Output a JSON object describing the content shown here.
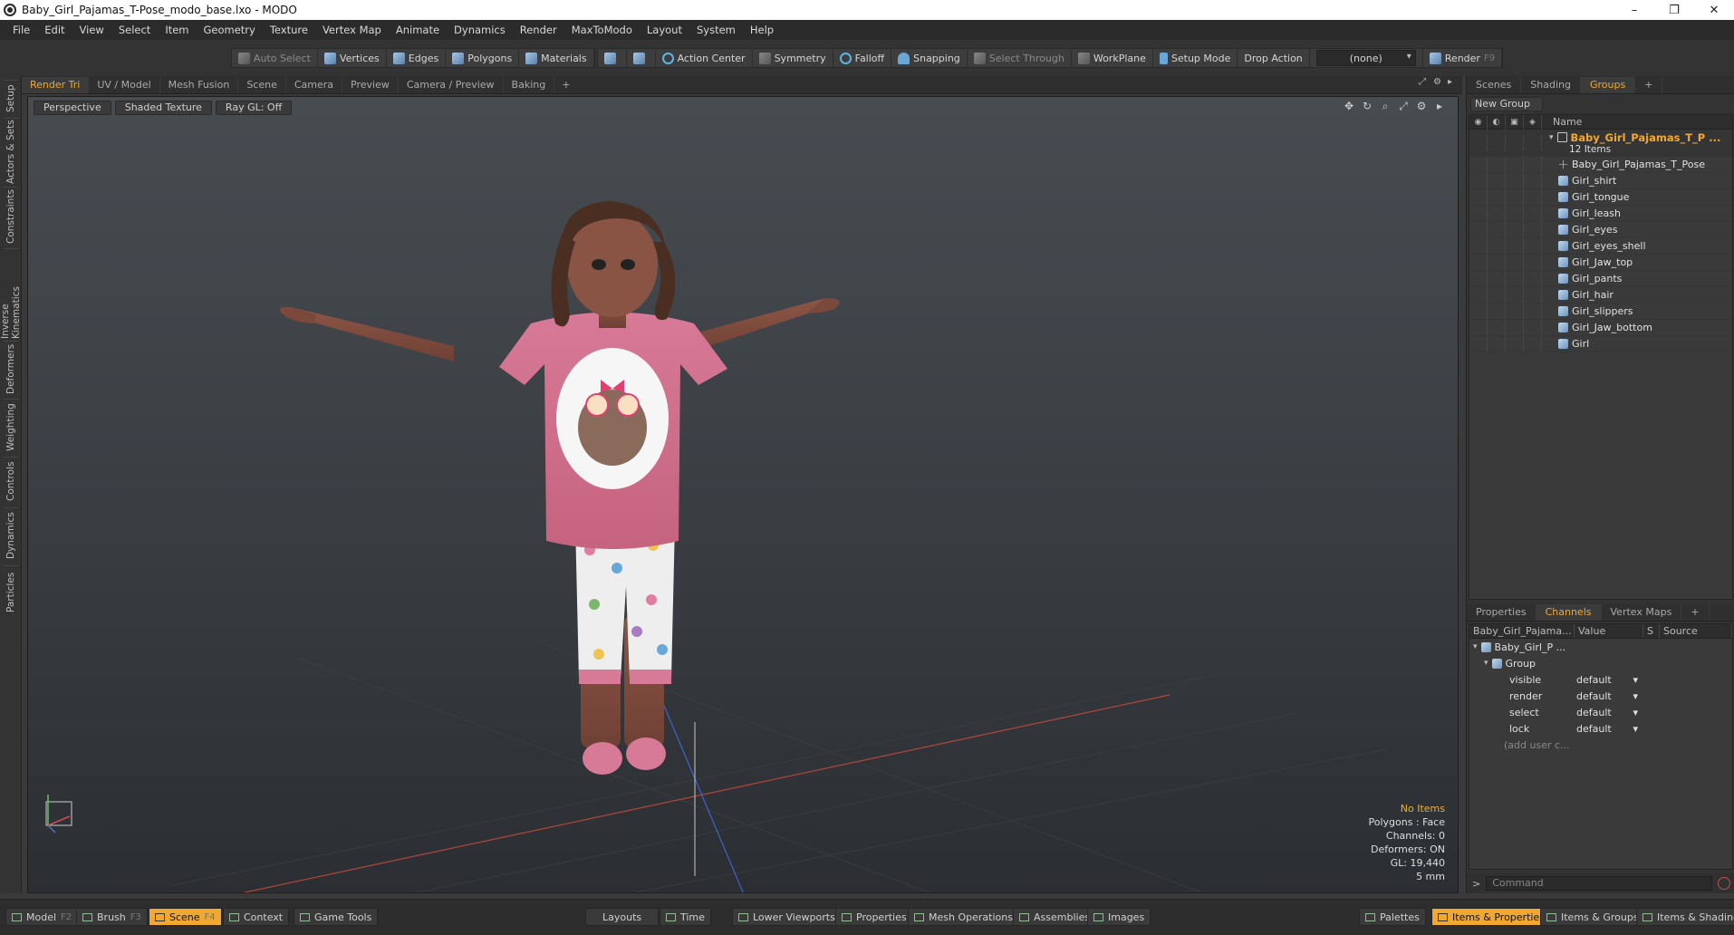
{
  "window": {
    "title": "Baby_Girl_Pajamas_T-Pose_modo_base.lxo - MODO",
    "minimize": "–",
    "maximize": "❐",
    "close": "✕"
  },
  "menu": [
    "File",
    "Edit",
    "View",
    "Select",
    "Item",
    "Geometry",
    "Texture",
    "Vertex Map",
    "Animate",
    "Dynamics",
    "Render",
    "MaxToModo",
    "Layout",
    "System",
    "Help"
  ],
  "toolbar": {
    "auto_select": "Auto Select",
    "vertices": "Vertices",
    "edges": "Edges",
    "polygons": "Polygons",
    "materials": "Materials",
    "action_center": "Action Center",
    "symmetry": "Symmetry",
    "falloff": "Falloff",
    "snapping": "Snapping",
    "select_through": "Select Through",
    "workplane": "WorkPlane",
    "setup_mode": "Setup Mode",
    "drop_action_label": "Drop Action",
    "drop_action_value": "(none)",
    "render": "Render",
    "render_key": "F9"
  },
  "left_tabs": [
    "Setup",
    "Actors & Sets",
    "Constraints",
    "Inverse Kinematics",
    "Deformers",
    "Weighting",
    "Controls",
    "Dynamics",
    "Particles"
  ],
  "viewport_tabs": [
    "Render Tri",
    "UV / Model",
    "Mesh Fusion",
    "Scene",
    "Camera",
    "Preview",
    "Camera / Preview",
    "Baking"
  ],
  "viewport_tabs_plus": "+",
  "viewport": {
    "perspective": "Perspective",
    "shading": "Shaded Texture",
    "raygl": "Ray GL: Off",
    "hud": {
      "no_items": "No Items",
      "polygons": "Polygons : Face",
      "channels": "Channels: 0",
      "deformers": "Deformers: ON",
      "gl": "GL: 19,440",
      "scale": "5 mm"
    }
  },
  "right_tabs": [
    "Scenes",
    "Shading",
    "Groups"
  ],
  "right_tabs_plus": "+",
  "groups": {
    "new_group": "New Group",
    "name_header": "Name",
    "group_name": "Baby_Girl_Pajamas_T_P ...",
    "group_count": "12 Items",
    "items": [
      "Baby_Girl_Pajamas_T_Pose",
      "Girl_shirt",
      "Girl_tongue",
      "Girl_leash",
      "Girl_eyes",
      "Girl_eyes_shell",
      "Girl_Jaw_top",
      "Girl_pants",
      "Girl_hair",
      "Girl_slippers",
      "Girl_Jaw_bottom",
      "Girl"
    ]
  },
  "channel_tabs": [
    "Properties",
    "Channels",
    "Vertex Maps"
  ],
  "channel_tabs_plus": "+",
  "channels": {
    "header_name": "Baby_Girl_Pajama...",
    "header_value": "Value",
    "header_s": "S",
    "header_source": "Source",
    "item": "Baby_Girl_P ...",
    "group": "Group",
    "rows": [
      {
        "name": "visible",
        "value": "default"
      },
      {
        "name": "render",
        "value": "default"
      },
      {
        "name": "select",
        "value": "default"
      },
      {
        "name": "lock",
        "value": "default"
      }
    ],
    "add_user": "(add user c..."
  },
  "command": {
    "prompt": ">",
    "placeholder": "Command"
  },
  "bottom": {
    "model": "Model",
    "model_key": "F2",
    "brush": "Brush",
    "brush_key": "F3",
    "scene": "Scene",
    "scene_key": "F4",
    "context": "Context",
    "game_tools": "Game Tools",
    "layouts": "Layouts",
    "time": "Time",
    "lower_viewports": "Lower Viewports",
    "properties": "Properties",
    "mesh_operations": "Mesh Operations",
    "assemblies": "Assemblies",
    "images": "Images",
    "palettes": "Palettes",
    "items_properties": "Items & Properties",
    "items_groups": "Items & Groups",
    "items_shading": "Items & Shading"
  },
  "colors": {
    "accent": "#f0a830",
    "shirt": "#d77a97",
    "skin": "#8a5444",
    "hair": "#4a2e22"
  }
}
